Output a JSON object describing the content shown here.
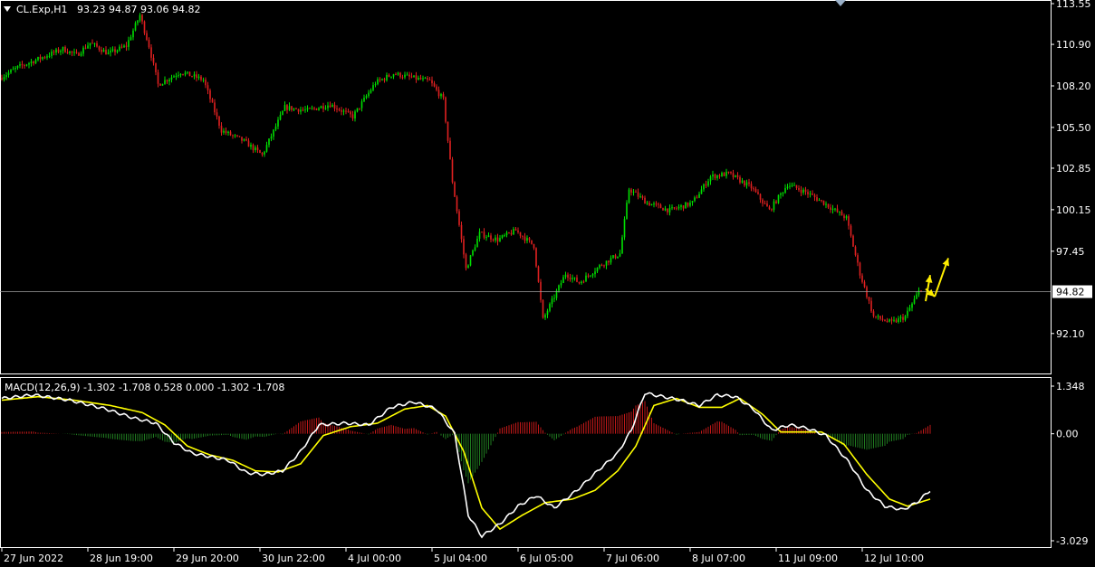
{
  "chart_data": [
    {
      "type": "candlestick",
      "panel": "price",
      "symbol_label": "CL.Exp,H1",
      "ohlc_label": "93.23 94.87 93.06 94.82",
      "ylim": [
        90.5,
        113.55
      ],
      "y_ticks": [
        "113.55",
        "110.90",
        "108.20",
        "105.50",
        "102.85",
        "100.15",
        "97.45",
        "94.82",
        "92.10"
      ],
      "current_price": "94.82",
      "current_price_value": 94.82,
      "up_color": "#00e000",
      "down_color": "#e02020",
      "arrow_color": "#ffee00",
      "path_keypoints": [
        [
          0,
          108.7
        ],
        [
          8,
          109.4
        ],
        [
          18,
          110.0
        ],
        [
          28,
          110.6
        ],
        [
          34,
          110.2
        ],
        [
          40,
          111.0
        ],
        [
          48,
          110.3
        ],
        [
          56,
          110.8
        ],
        [
          62,
          112.8
        ],
        [
          66,
          110.8
        ],
        [
          70,
          108.3
        ],
        [
          80,
          109.1
        ],
        [
          90,
          108.6
        ],
        [
          98,
          105.3
        ],
        [
          108,
          104.6
        ],
        [
          116,
          103.7
        ],
        [
          126,
          106.8
        ],
        [
          136,
          106.6
        ],
        [
          146,
          107.0
        ],
        [
          156,
          106.2
        ],
        [
          166,
          108.4
        ],
        [
          174,
          109.0
        ],
        [
          180,
          108.8
        ],
        [
          190,
          108.5
        ],
        [
          196,
          107.3
        ],
        [
          200,
          102.0
        ],
        [
          206,
          96.3
        ],
        [
          212,
          98.6
        ],
        [
          220,
          98.2
        ],
        [
          228,
          98.8
        ],
        [
          236,
          97.8
        ],
        [
          240,
          93.0
        ],
        [
          250,
          96.0
        ],
        [
          256,
          95.4
        ],
        [
          266,
          96.6
        ],
        [
          274,
          97.3
        ],
        [
          278,
          101.5
        ],
        [
          286,
          100.6
        ],
        [
          296,
          100.1
        ],
        [
          306,
          100.6
        ],
        [
          314,
          102.3
        ],
        [
          322,
          102.5
        ],
        [
          332,
          101.6
        ],
        [
          340,
          100.1
        ],
        [
          348,
          101.8
        ],
        [
          356,
          101.3
        ],
        [
          364,
          100.6
        ],
        [
          374,
          99.6
        ],
        [
          380,
          96.0
        ],
        [
          386,
          93.2
        ],
        [
          394,
          92.8
        ],
        [
          400,
          93.2
        ],
        [
          406,
          94.82
        ]
      ],
      "annotation_arrows": [
        {
          "from_bar": 408,
          "from": 94.2,
          "to_bar": 410,
          "to": 95.9
        },
        {
          "from_bar": 408,
          "from": 95.0,
          "to_bar": 412,
          "to": 94.5
        },
        {
          "from_bar": 412,
          "from": 94.5,
          "to_bar": 418,
          "to": 97.0
        }
      ]
    },
    {
      "type": "macd",
      "panel": "indicator",
      "label": "MACD(12,26,9) -1.302 -1.708 0.528 0.000 -1.302 -1.708",
      "ylim": [
        -3.029,
        1.348
      ],
      "y_ticks": [
        "1.348",
        "0.00",
        "-3.029"
      ],
      "macd_color": "#ffffff",
      "signal_color": "#ffff00",
      "hist_pos_color": "#c01818",
      "hist_neg_color": "#1f7a1f",
      "macd_keypoints": [
        [
          0,
          1.0
        ],
        [
          14,
          1.1
        ],
        [
          30,
          0.95
        ],
        [
          46,
          0.7
        ],
        [
          58,
          0.45
        ],
        [
          68,
          0.3
        ],
        [
          76,
          -0.25
        ],
        [
          84,
          -0.55
        ],
        [
          92,
          -0.65
        ],
        [
          100,
          -0.75
        ],
        [
          108,
          -1.1
        ],
        [
          116,
          -1.15
        ],
        [
          124,
          -1.05
        ],
        [
          132,
          -0.5
        ],
        [
          140,
          0.25
        ],
        [
          152,
          0.3
        ],
        [
          162,
          0.25
        ],
        [
          172,
          0.75
        ],
        [
          182,
          0.9
        ],
        [
          192,
          0.7
        ],
        [
          200,
          0.0
        ],
        [
          206,
          -2.3
        ],
        [
          212,
          -2.9
        ],
        [
          220,
          -2.55
        ],
        [
          228,
          -2.05
        ],
        [
          236,
          -1.75
        ],
        [
          244,
          -2.1
        ],
        [
          254,
          -1.6
        ],
        [
          264,
          -1.0
        ],
        [
          272,
          -0.55
        ],
        [
          278,
          0.1
        ],
        [
          284,
          1.15
        ],
        [
          292,
          1.05
        ],
        [
          300,
          0.95
        ],
        [
          308,
          0.8
        ],
        [
          316,
          1.1
        ],
        [
          324,
          1.05
        ],
        [
          332,
          0.7
        ],
        [
          340,
          0.1
        ],
        [
          348,
          0.25
        ],
        [
          356,
          0.15
        ],
        [
          364,
          -0.05
        ],
        [
          374,
          -0.8
        ],
        [
          382,
          -1.6
        ],
        [
          390,
          -2.05
        ],
        [
          398,
          -2.15
        ],
        [
          404,
          -1.95
        ],
        [
          410,
          -1.6
        ]
      ],
      "signal_keypoints": [
        [
          0,
          0.95
        ],
        [
          16,
          1.05
        ],
        [
          32,
          0.95
        ],
        [
          48,
          0.8
        ],
        [
          62,
          0.6
        ],
        [
          72,
          0.25
        ],
        [
          82,
          -0.35
        ],
        [
          92,
          -0.6
        ],
        [
          102,
          -0.75
        ],
        [
          112,
          -1.05
        ],
        [
          122,
          -1.08
        ],
        [
          132,
          -0.85
        ],
        [
          142,
          -0.05
        ],
        [
          154,
          0.2
        ],
        [
          166,
          0.3
        ],
        [
          178,
          0.7
        ],
        [
          188,
          0.8
        ],
        [
          196,
          0.5
        ],
        [
          204,
          -0.5
        ],
        [
          212,
          -2.1
        ],
        [
          220,
          -2.7
        ],
        [
          230,
          -2.3
        ],
        [
          240,
          -1.95
        ],
        [
          252,
          -1.85
        ],
        [
          262,
          -1.6
        ],
        [
          272,
          -1.05
        ],
        [
          280,
          -0.35
        ],
        [
          288,
          0.8
        ],
        [
          298,
          1.0
        ],
        [
          308,
          0.75
        ],
        [
          318,
          0.75
        ],
        [
          326,
          1.0
        ],
        [
          336,
          0.55
        ],
        [
          344,
          0.05
        ],
        [
          352,
          0.05
        ],
        [
          362,
          0.05
        ],
        [
          372,
          -0.3
        ],
        [
          382,
          -1.15
        ],
        [
          392,
          -1.85
        ],
        [
          400,
          -2.05
        ],
        [
          410,
          -1.85
        ]
      ]
    }
  ],
  "x_axis": {
    "labels": [
      {
        "text": "27 Jun 2022",
        "bar": 0
      },
      {
        "text": "28 Jun 19:00",
        "bar": 38
      },
      {
        "text": "29 Jun 20:00",
        "bar": 76
      },
      {
        "text": "30 Jun 22:00",
        "bar": 114
      },
      {
        "text": "4 Jul 00:00",
        "bar": 152
      },
      {
        "text": "5 Jul 04:00",
        "bar": 190
      },
      {
        "text": "6 Jul 05:00",
        "bar": 228
      },
      {
        "text": "7 Jul 06:00",
        "bar": 266
      },
      {
        "text": "8 Jul 07:00",
        "bar": 304
      },
      {
        "text": "11 Jul 09:00",
        "bar": 342
      },
      {
        "text": "12 Jul 10:00",
        "bar": 380
      }
    ]
  }
}
